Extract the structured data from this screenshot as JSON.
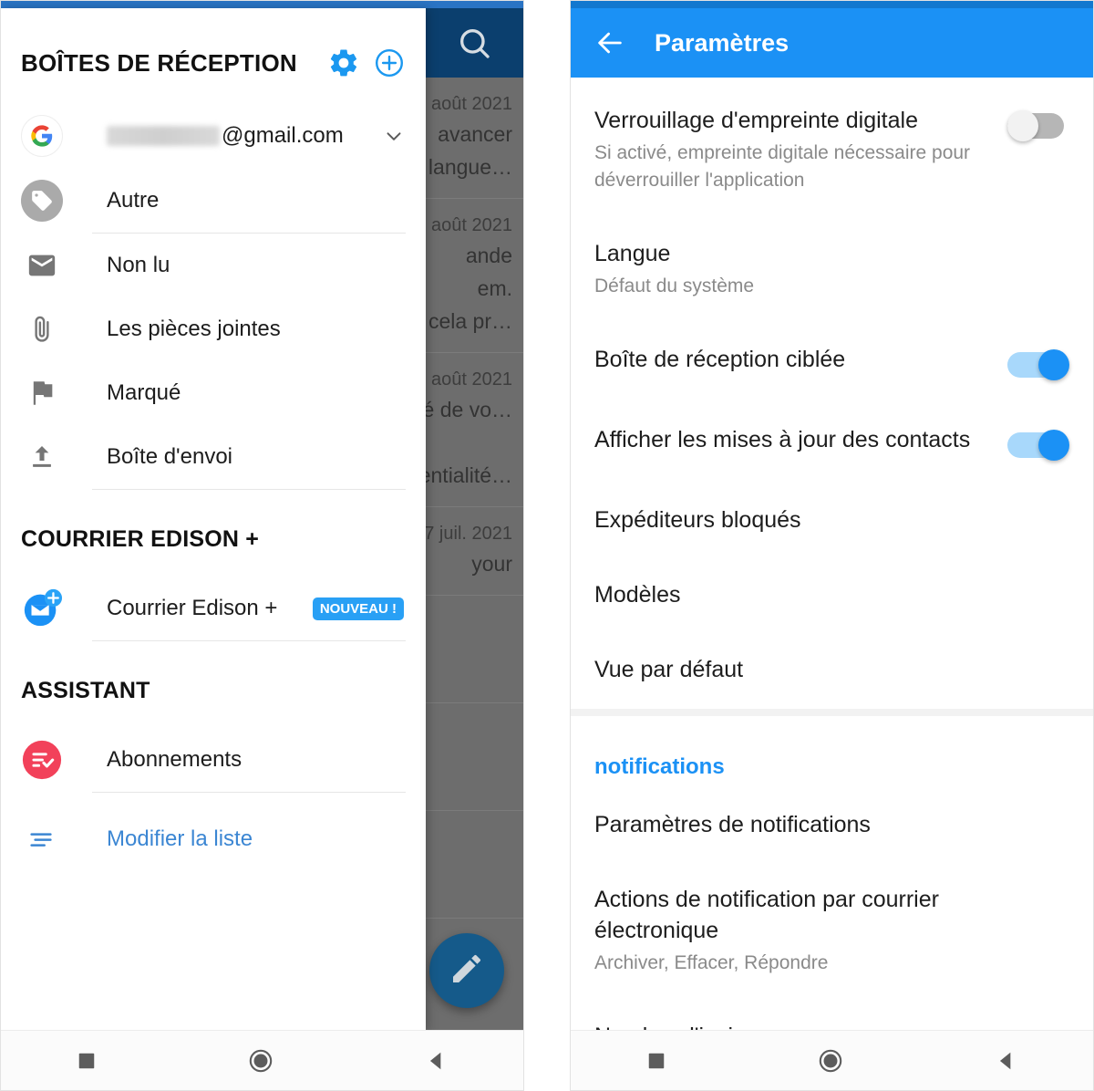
{
  "left_phone": {
    "background_mail": {
      "search_icon": "search-icon",
      "rows": [
        {
          "date": "août 2021",
          "lines": [
            "avancer",
            "langue…"
          ]
        },
        {
          "date": "août 2021",
          "lines": [
            "ande",
            "em.",
            "cela pr…"
          ]
        },
        {
          "date": "août 2021",
          "lines": [
            "é de vo…",
            "",
            "entialité…"
          ]
        },
        {
          "date": "7 juil. 2021",
          "lines": [
            "your"
          ]
        }
      ],
      "compose_fab": "compose-icon"
    },
    "drawer": {
      "title": "BOÎTES DE RÉCEPTION",
      "settings_icon": "gear-icon",
      "add_icon": "plus-circle-icon",
      "account": {
        "provider_icon": "google-icon",
        "name_redacted": "",
        "domain": "@gmail.com",
        "expand_icon": "chevron-down-icon"
      },
      "other_item": {
        "label": "Autre",
        "icon": "tag-icon"
      },
      "filters": [
        {
          "label": "Non lu",
          "icon": "envelope-icon"
        },
        {
          "label": "Les pièces jointes",
          "icon": "paperclip-icon"
        },
        {
          "label": "Marqué",
          "icon": "flag-icon"
        },
        {
          "label": "Boîte d'envoi",
          "icon": "outbox-upload-icon"
        }
      ],
      "section_edison": {
        "header": "COURRIER EDISON +",
        "item_label": "Courrier Edison +",
        "item_icon": "edison-mail-plus-icon",
        "badge": "NOUVEAU !"
      },
      "section_assistant": {
        "header": "ASSISTANT",
        "item_label": "Abonnements",
        "item_icon": "subscriptions-icon"
      },
      "edit_list": {
        "label": "Modifier la liste",
        "icon": "edit-list-icon"
      }
    },
    "navbar": {
      "recent": "square-recents-icon",
      "home": "circle-home-icon",
      "back": "triangle-back-icon"
    }
  },
  "right_phone": {
    "appbar": {
      "back_icon": "arrow-back-icon",
      "title": "Paramètres"
    },
    "groups": [
      {
        "rows": [
          {
            "title": "Verrouillage d'empreinte digitale",
            "sub": "Si activé, empreinte digitale nécessaire pour déverrouiller l'application",
            "control": "switch",
            "state": "off"
          },
          {
            "title": "Langue",
            "sub": "Défaut du système",
            "control": "none",
            "state": ""
          },
          {
            "title": "Boîte de réception ciblée",
            "sub": "",
            "control": "switch",
            "state": "on"
          },
          {
            "title": "Afficher les mises à jour des contacts",
            "sub": "",
            "control": "switch",
            "state": "on"
          },
          {
            "title": "Expéditeurs bloqués",
            "sub": "",
            "control": "none",
            "state": ""
          },
          {
            "title": "Modèles",
            "sub": "",
            "control": "none",
            "state": ""
          },
          {
            "title": "Vue par défaut",
            "sub": "",
            "control": "none",
            "state": ""
          }
        ]
      },
      {
        "header": "notifications",
        "rows": [
          {
            "title": "Paramètres de notifications",
            "sub": "",
            "control": "none",
            "state": ""
          },
          {
            "title": "Actions de notification par courrier électronique",
            "sub": "Archiver, Effacer, Répondre",
            "control": "none",
            "state": ""
          },
          {
            "title": "Nombre d'insignes",
            "sub": "",
            "control": "none",
            "state": ""
          }
        ]
      }
    ],
    "navbar": {
      "recent": "square-recents-icon",
      "home": "circle-home-icon",
      "back": "triangle-back-icon"
    }
  },
  "colors": {
    "accent_blue": "#1b91f5",
    "appbar_blue": "#1b91f5",
    "dim_overlay": "#6d6d6d",
    "mail_appbar_dark": "#0b3f6e",
    "badge_blue": "#29a0f5",
    "link_blue": "#3b86d3",
    "subscriptions_red": "#f2415a"
  }
}
